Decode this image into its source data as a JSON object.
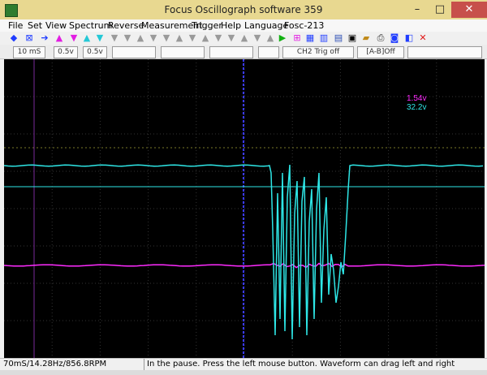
{
  "window": {
    "title": "Focus Oscillograph software 359",
    "minimize_glyph": "–",
    "maximize_glyph": "□",
    "close_glyph": "✕"
  },
  "menu": [
    "File",
    "Set",
    "View",
    "Spectrum",
    "Reverse",
    "Measurement",
    "Trigger",
    "Help",
    "Language",
    "Fosc-213"
  ],
  "toolbar": {
    "icons": [
      "left-arrow-icon",
      "cross-box-icon",
      "right-arrow-icon",
      "up-triangle-magenta-icon",
      "down-triangle-magenta-icon",
      "up-triangle-cyan-icon",
      "down-triangle-cyan-icon",
      "play-icon",
      "meter-icon",
      "grid-icon",
      "settings-icon",
      "save-icon",
      "open-icon",
      "print-icon",
      "camera-icon",
      "close-icon"
    ]
  },
  "params": {
    "timebase": "10 mS",
    "ch1_volts": "0.5v",
    "ch2_volts": "0.5v",
    "trigger": "CH2 Trig off",
    "math": "[A-B]Off"
  },
  "readouts": {
    "ch1_value": "1.54v",
    "ch2_value": "32.2v"
  },
  "colors": {
    "ch1": "#ff2bff",
    "ch2": "#2ee6e6",
    "cursor": "#3a3aff",
    "grid": "#3a3a3a",
    "trigger_marker": "#7a7a2a"
  },
  "status": {
    "left": "70mS/14.28Hz/856.8RPM",
    "right": "In the pause. Press the left mouse button. Waveform can drag left and right"
  }
}
